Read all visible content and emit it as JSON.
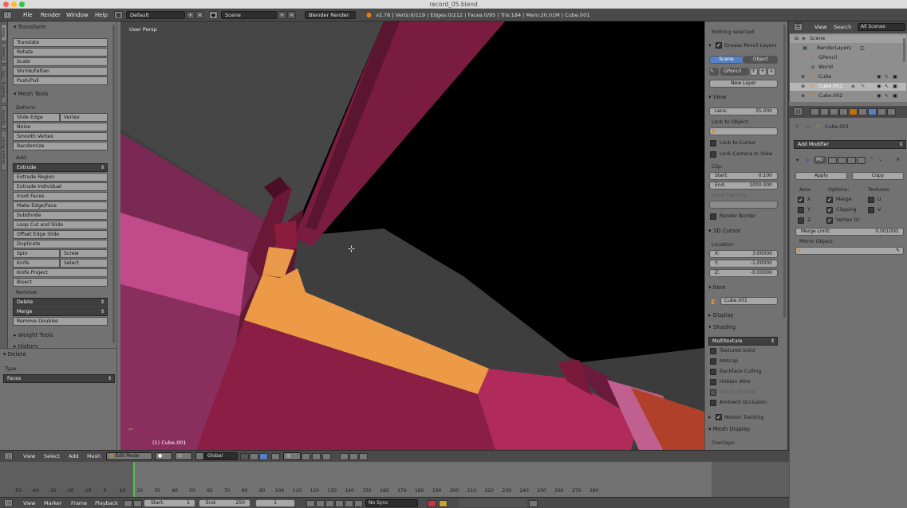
{
  "window": {
    "title": "record_05.blend"
  },
  "info_header": {
    "menus": [
      "File",
      "Render",
      "Window",
      "Help"
    ],
    "layout": "Default",
    "scene": "Scene",
    "engine": "Blender Render",
    "stats": "v2.78 | Verts:0/119 | Edges:0/212 | Faces:0/95 | Tris:184 | Mem:20.01M | Cube.001"
  },
  "tabs": [
    "Tools",
    "Create",
    "Shading / UVs",
    "Options",
    "Grease Pencil"
  ],
  "toolshelf": {
    "transform_header": "Transform",
    "transform": [
      "Translate",
      "Rotate",
      "Scale",
      "Shrink/Fatten",
      "Push/Pull"
    ],
    "mesh_tools_header": "Mesh Tools",
    "deform_label": "Deform:",
    "slide_edge": "Slide Edge",
    "vertex": "Vertex",
    "deform_rest": [
      "Noise",
      "Smooth Vertex",
      "Randomize"
    ],
    "add_label": "Add:",
    "extrude": "Extrude",
    "add_items": [
      "Extrude Region",
      "Extrude Individual",
      "Inset Faces",
      "Make Edge/Face",
      "Subdivide",
      "Loop Cut and Slide",
      "Offset Edge Slide",
      "Duplicate"
    ],
    "spin": "Spin",
    "screw": "Screw",
    "knife": "Knife",
    "select": "Select",
    "knife_project": "Knife Project",
    "bisect": "Bisect",
    "remove_label": "Remove:",
    "delete": "Delete",
    "merge": "Merge",
    "remove_doubles": "Remove Doubles",
    "weight_tools": "Weight Tools",
    "history": "History"
  },
  "operator_panel": {
    "title": "Delete",
    "type_label": "Type",
    "type_value": "Faces"
  },
  "viewport": {
    "label": "User Persp",
    "object_label": "(1) Cube.001",
    "colors": {
      "mesh_dark": "#6e1a36",
      "mesh_mid": "#8a1e44",
      "mesh_pink": "#c64a8e",
      "selected_face": "#ec9a46",
      "background": "#3e3e3e"
    }
  },
  "npanel": {
    "nothing_selected": "Nothing selected",
    "gp_layers": "Grease Pencil Layers",
    "scene_btn": "Scene",
    "object_btn": "Object",
    "gpencil": "GPencil",
    "f": "F",
    "new_layer": "New Layer",
    "view_header": "View",
    "lens_label": "Lens:",
    "lens_value": "35.000",
    "lock_to_object": "Lock to Object:",
    "lock_to_cursor": "Lock to Cursor",
    "lock_camera": "Lock Camera to View",
    "clip_label": "Clip:",
    "clip_start_label": "Start:",
    "clip_start": "0.100",
    "clip_end_label": "End:",
    "clip_end": "1000.000",
    "local_camera": "Local Camera:",
    "render_border": "Render Border",
    "cursor_header": "3D Cursor",
    "location_label": "Location:",
    "x_label": "X:",
    "x": "3.00000",
    "y_label": "Y:",
    "y": "-1.00000",
    "z_label": "Z:",
    "z": "-0.00000",
    "item_header": "Item",
    "item_name": "Cube.001",
    "display_header": "Display",
    "shading_header": "Shading",
    "multitexture": "Multitexture",
    "shading_opts": [
      "Textured Solid",
      "Matcap",
      "Backface Culling",
      "Hidden Wire",
      "Depth Of Field",
      "Ambient Occlusion"
    ],
    "motion_tracking": "Motion Tracking",
    "mesh_display": "Mesh Display",
    "overlays": "Overlays:"
  },
  "outliner": {
    "view": "View",
    "search": "Search",
    "scenes": "All Scenes",
    "items": [
      "Scene",
      "RenderLayers",
      "GPencil",
      "World",
      "Cube",
      "Cube.001",
      "Cube.002"
    ]
  },
  "properties": {
    "object_name": "Cube.001",
    "add_modifier": "Add Modifier",
    "mod_name": "Mir",
    "apply": "Apply",
    "copy": "Copy",
    "axis_label": "Axis:",
    "options_label": "Options:",
    "textures_label": "Textures:",
    "axes": [
      "X",
      "Y",
      "Z"
    ],
    "options": [
      "Merge",
      "Clipping",
      "Vertex Gr"
    ],
    "textures": [
      "U",
      "V"
    ],
    "merge_limit_label": "Merge Limit:",
    "merge_limit": "0.001000",
    "mirror_object": "Mirror Object:"
  },
  "view3d_header": {
    "menus": [
      "View",
      "Select",
      "Add",
      "Mesh"
    ],
    "mode": "Edit Mode",
    "orientation": "Global"
  },
  "timeline": {
    "ticks": [
      "-50",
      "-40",
      "-30",
      "-20",
      "-10",
      "0",
      "10",
      "20",
      "30",
      "40",
      "50",
      "60",
      "70",
      "80",
      "90",
      "100",
      "110",
      "120",
      "130",
      "140",
      "150",
      "160",
      "170",
      "180",
      "190",
      "200",
      "210",
      "220",
      "230",
      "240",
      "250",
      "260",
      "270",
      "280"
    ],
    "current_frame": "1",
    "header_menus": [
      "View",
      "Marker",
      "Frame",
      "Playback"
    ],
    "start_label": "Start:",
    "start": "1",
    "end_label": "End:",
    "end": "250",
    "frame": "1",
    "sync": "No Sync"
  }
}
